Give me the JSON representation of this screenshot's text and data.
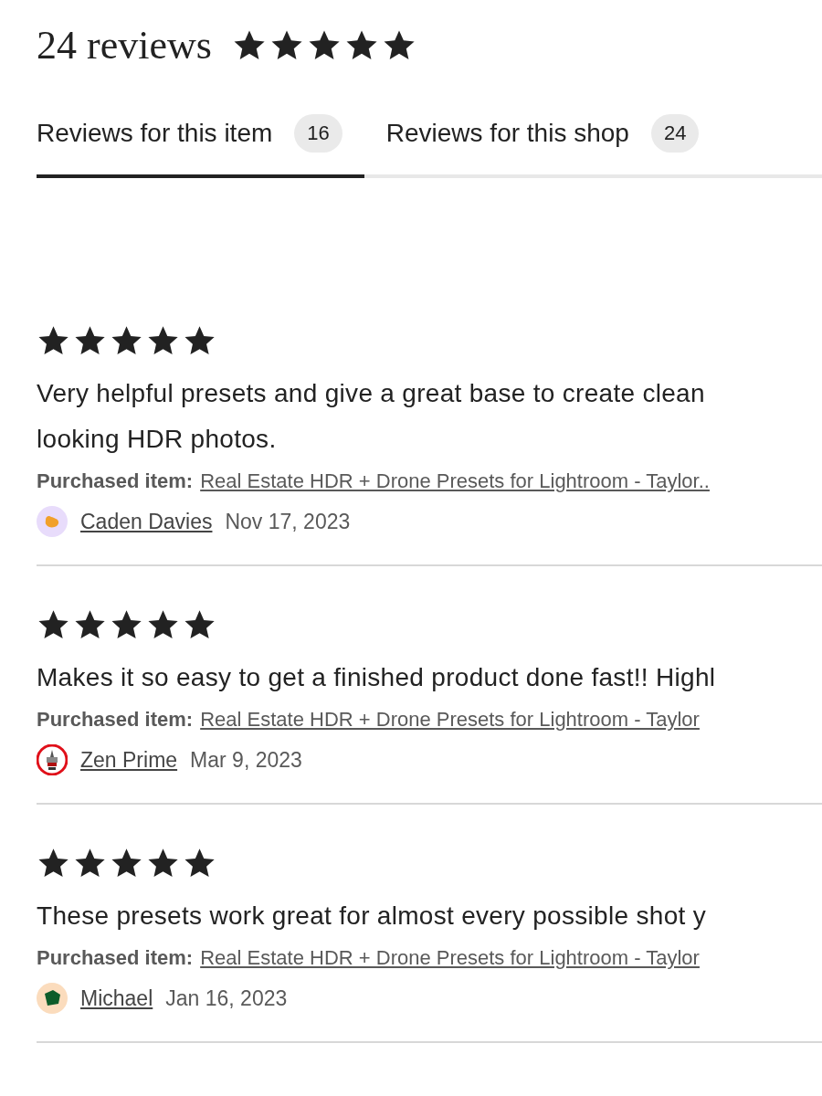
{
  "header": {
    "title": "24 reviews",
    "stars": 5
  },
  "tabs": [
    {
      "label": "Reviews for this item",
      "count": "16",
      "selected": true
    },
    {
      "label": "Reviews for this shop",
      "count": "24",
      "selected": false
    }
  ],
  "reviews": [
    {
      "stars": 5,
      "text": "Very helpful presets and give a great base to create clean looking HDR photos.",
      "purchased_label": "Purchased item:",
      "purchased_item": "Real Estate HDR + Drone Presets for Lightroom - Taylor..",
      "author": "Caden Davies",
      "date": "Nov 17, 2023",
      "avatar": {
        "kind": "blob"
      }
    },
    {
      "stars": 5,
      "text": "Makes it so easy to get a finished product done fast!! Highl",
      "purchased_label": "Purchased item:",
      "purchased_item": "Real Estate HDR + Drone Presets for Lightroom - Taylor",
      "author": "Zen Prime",
      "date": "Mar 9, 2023",
      "avatar": {
        "kind": "badge"
      }
    },
    {
      "stars": 5,
      "text": "These presets work great for almost every possible shot y",
      "purchased_label": "Purchased item:",
      "purchased_item": "Real Estate HDR + Drone Presets for Lightroom - Taylor",
      "author": "Michael",
      "date": "Jan 16, 2023",
      "avatar": {
        "kind": "pentagon"
      }
    }
  ]
}
